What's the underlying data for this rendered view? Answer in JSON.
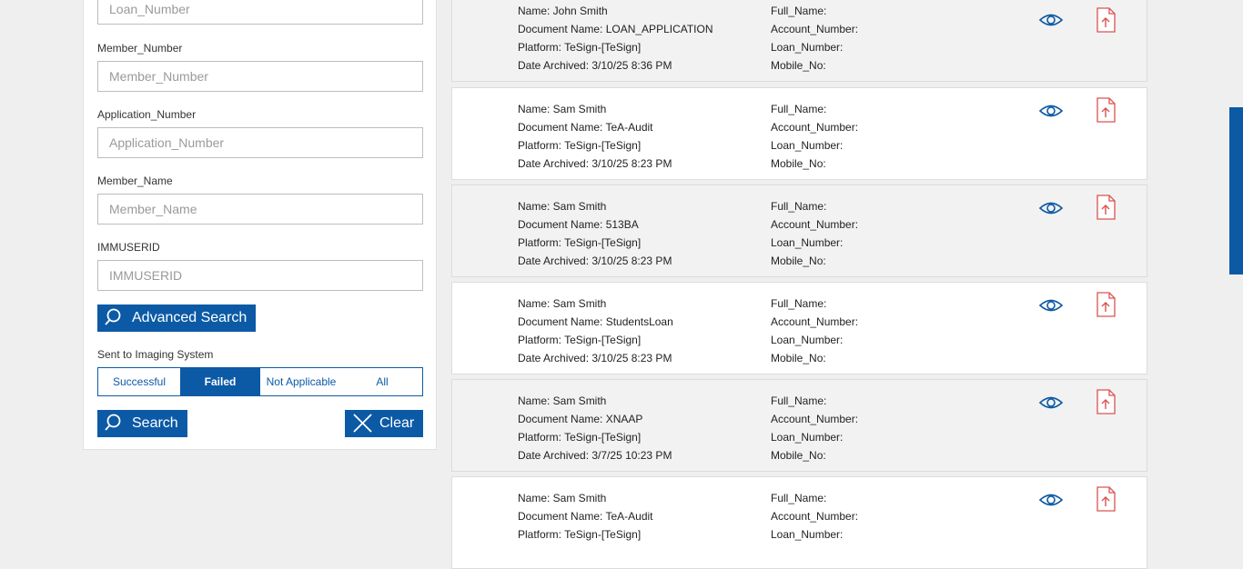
{
  "filters": {
    "loan_number": {
      "placeholder": "Loan_Number"
    },
    "member_number": {
      "label": "Member_Number",
      "placeholder": "Member_Number"
    },
    "application_number": {
      "label": "Application_Number",
      "placeholder": "Application_Number"
    },
    "member_name": {
      "label": "Member_Name",
      "placeholder": "Member_Name"
    },
    "immuserid": {
      "label": "IMMUSERID",
      "placeholder": "IMMUSERID"
    },
    "advanced_search_label": "Advanced Search",
    "imaging_label": "Sent to Imaging System",
    "imaging_options": [
      "Successful",
      "Failed",
      "Not Applicable",
      "All"
    ],
    "imaging_selected": "Failed",
    "search_label": "Search",
    "clear_label": "Clear"
  },
  "results": [
    {
      "name": "Name: John Smith",
      "document": "Document Name: LOAN_APPLICATION",
      "platform": "Platform: TeSign-[TeSign]",
      "date": "Date Archived: 3/10/25 8:36 PM",
      "full_name": "Full_Name:",
      "account": "Account_Number:",
      "loan": "Loan_Number:",
      "mobile": "Mobile_No:"
    },
    {
      "name": "Name: Sam Smith",
      "document": "Document Name: TeA-Audit",
      "platform": "Platform: TeSign-[TeSign]",
      "date": "Date Archived: 3/10/25 8:23 PM",
      "full_name": "Full_Name:",
      "account": "Account_Number:",
      "loan": "Loan_Number:",
      "mobile": "Mobile_No:"
    },
    {
      "name": "Name: Sam Smith",
      "document": "Document Name: 513BA",
      "platform": "Platform: TeSign-[TeSign]",
      "date": "Date Archived: 3/10/25 8:23 PM",
      "full_name": "Full_Name:",
      "account": "Account_Number:",
      "loan": "Loan_Number:",
      "mobile": "Mobile_No:"
    },
    {
      "name": "Name: Sam Smith",
      "document": "Document Name: StudentsLoan",
      "platform": "Platform: TeSign-[TeSign]",
      "date": "Date Archived: 3/10/25 8:23 PM",
      "full_name": "Full_Name:",
      "account": "Account_Number:",
      "loan": "Loan_Number:",
      "mobile": "Mobile_No:"
    },
    {
      "name": "Name: Sam Smith",
      "document": "Document Name: XNAAP",
      "platform": "Platform: TeSign-[TeSign]",
      "date": "Date Archived: 3/7/25 10:23 PM",
      "full_name": "Full_Name:",
      "account": "Account_Number:",
      "loan": "Loan_Number:",
      "mobile": "Mobile_No:"
    },
    {
      "name": "Name: Sam Smith",
      "document": "Document Name: TeA-Audit",
      "platform": "Platform: TeSign-[TeSign]",
      "date": "",
      "full_name": "Full_Name:",
      "account": "Account_Number:",
      "loan": "Loan_Number:",
      "mobile": ""
    }
  ],
  "colors": {
    "primary": "#0c5aa6",
    "pdf_icon": "#d9534f",
    "card_grey": "#f2f2f2",
    "page_bg": "#efefef"
  },
  "icons": {
    "view": "eye-icon",
    "document": "pdf-icon",
    "search": "search-icon",
    "clear": "close-icon"
  }
}
